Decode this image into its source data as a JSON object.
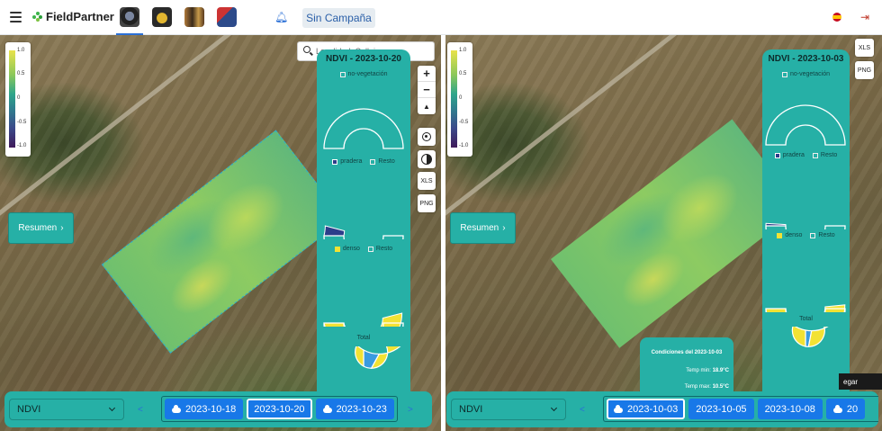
{
  "header": {
    "app_name": "FieldPartner",
    "campaign_button": "Sin Campaña",
    "brand_color": "#3cb44b",
    "accent_color": "#2a6fd6"
  },
  "legend": {
    "ticks": [
      "1.0",
      "0.5",
      "0",
      "-0.5",
      "-1.0"
    ]
  },
  "left": {
    "search": {
      "value": "Localidad, Callejero..."
    },
    "panel": {
      "title": "NDVI - 2023-10-20",
      "checkbox_1": "no-vegetación",
      "checkbox_2": "pradera",
      "checkbox_2b": "Resto",
      "checkbox_3": "denso",
      "checkbox_3b": "Resto",
      "total_label": "Total"
    },
    "controls": {
      "zoom_in": "+",
      "zoom_out": "−",
      "north": "▲",
      "xls": "XLS",
      "png": "PNG"
    },
    "resumen_button": "Resumen",
    "index_select": "NDVI",
    "prev_arrow": "<",
    "next_arrow": ">",
    "dates": [
      "2023-10-18",
      "2023-10-20",
      "2023-10-23"
    ],
    "active_date": "2023-10-20"
  },
  "right": {
    "panel": {
      "title": "NDVI - 2023-10-03",
      "checkbox_1": "no-vegetación",
      "checkbox_2": "pradera",
      "checkbox_2b": "Resto",
      "checkbox_3": "denso",
      "checkbox_3b": "Resto",
      "total_label": "Total"
    },
    "controls": {
      "xls": "XLS",
      "png": "PNG"
    },
    "resumen_button": "Resumen",
    "conditions": {
      "title": "Condiciones del 2023-10-03",
      "temp_min_label": "Temp min:",
      "temp_min": "18.9°C",
      "temp_max_label": "Temp max:",
      "temp_max": "10.5°C"
    },
    "overflow_button": "egar",
    "index_select": "NDVI",
    "prev_arrow": "<",
    "next_arrow": ">",
    "dates": [
      "2023-10-03",
      "2023-10-05",
      "2023-10-08",
      "20"
    ],
    "active_date": "2023-10-03"
  },
  "charts": {
    "left_pradera_fraction": 0.08,
    "left_denso_fraction": 0.92,
    "left_total": [
      0.08,
      0.92
    ],
    "right_pradera_fraction": 0.02,
    "right_denso_fraction": 0.97,
    "right_total": [
      0.03,
      0.97
    ],
    "color_yellow": "#f2e234",
    "color_blue": "#2c3e8a",
    "color_lightblue": "#3a9be0"
  }
}
